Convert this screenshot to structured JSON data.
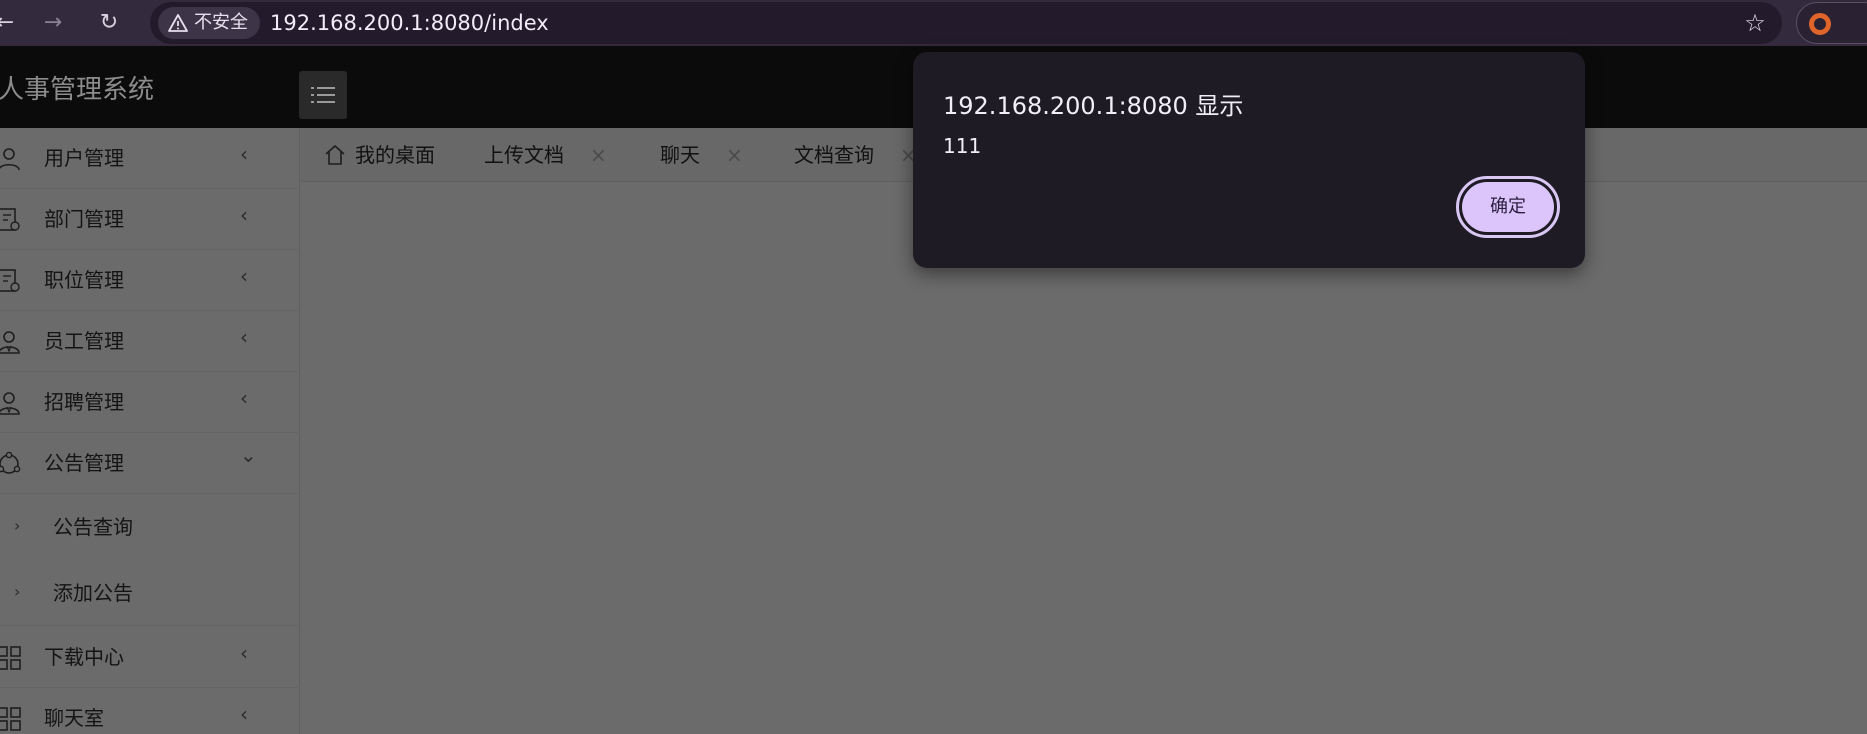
{
  "browser": {
    "security_label": "不安全",
    "url": "192.168.200.1:8080/index",
    "icons": [
      "back-icon",
      "forward-icon",
      "reload-icon",
      "warning-icon",
      "star-icon",
      "profile-icon"
    ]
  },
  "app": {
    "title": "人事管理系统"
  },
  "sidebar": {
    "items": [
      {
        "label": "用户管理",
        "icon": "user-icon",
        "expanded": false
      },
      {
        "label": "部门管理",
        "icon": "document-icon",
        "expanded": false
      },
      {
        "label": "职位管理",
        "icon": "document-icon",
        "expanded": false
      },
      {
        "label": "员工管理",
        "icon": "employee-icon",
        "expanded": false
      },
      {
        "label": "招聘管理",
        "icon": "employee-icon",
        "expanded": false
      },
      {
        "label": "公告管理",
        "icon": "share-icon",
        "expanded": true
      },
      {
        "label": "下载中心",
        "icon": "grid-icon",
        "expanded": false
      },
      {
        "label": "聊天室",
        "icon": "grid-icon",
        "expanded": false
      }
    ],
    "subitems": [
      {
        "label": "公告查询"
      },
      {
        "label": "添加公告"
      }
    ]
  },
  "tabs": [
    {
      "label": "我的桌面",
      "closable": false
    },
    {
      "label": "上传文档",
      "closable": true
    },
    {
      "label": "聊天",
      "closable": true
    },
    {
      "label": "文档查询",
      "closable": true
    }
  ],
  "dialog": {
    "title": "192.168.200.1:8080 显示",
    "message": "111",
    "ok_label": "确定"
  },
  "colors": {
    "browser_bar": "#332a3d",
    "header": "#0b0b0b",
    "overlay_gray": "#6b6b6b",
    "dialog_bg": "#1f1b24",
    "ok_button": "#dcc5fb"
  }
}
